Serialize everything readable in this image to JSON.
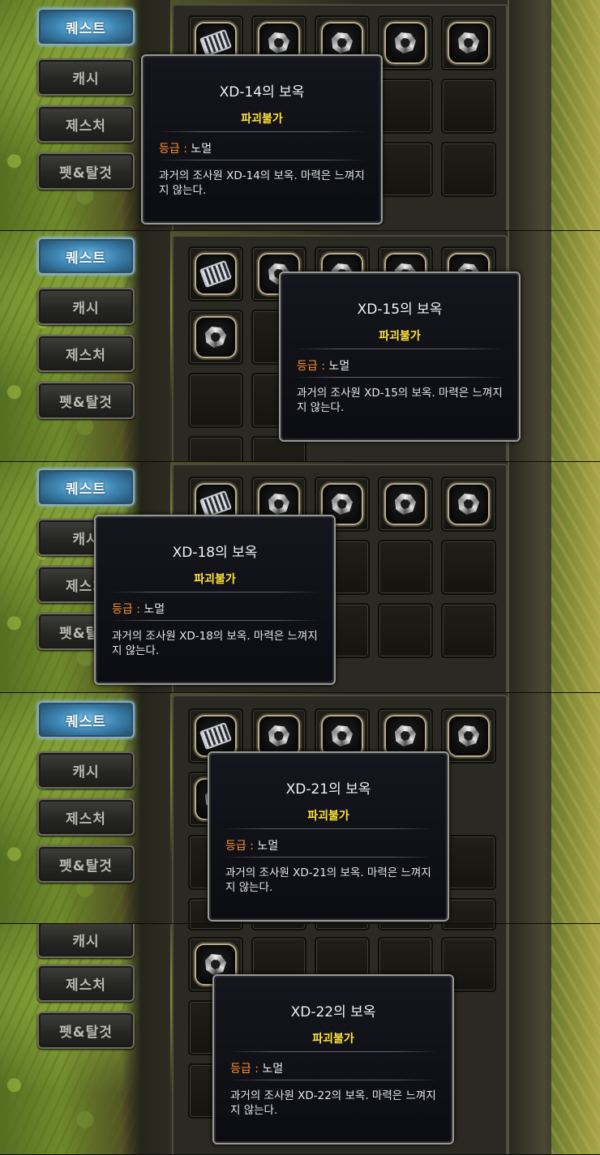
{
  "tabs": [
    "퀘스트",
    "캐시",
    "제스처",
    "펫&탈것"
  ],
  "common": {
    "destroy_flag": "파괴불가",
    "grade_label": "등급 :",
    "grade_value": "노멀"
  },
  "panels": [
    {
      "item_name": "XD-14의 보옥",
      "description": "과거의 조사원 XD-14의 보옥. 마력은 느껴지지 않는다."
    },
    {
      "item_name": "XD-15의 보옥",
      "description": "과거의 조사원 XD-15의 보옥. 마력은 느껴지지 않는다."
    },
    {
      "item_name": "XD-18의 보옥",
      "description": "과거의 조사원 XD-18의 보옥. 마력은 느껴지지 않는다."
    },
    {
      "item_name": "XD-21의 보옥",
      "description": "과거의 조사원 XD-21의 보옥. 마력은 느껴지지 않는다."
    },
    {
      "item_name": "XD-22의 보옥",
      "description": "과거의 조사원 XD-22의 보옥. 마력은 느껴지지 않는다."
    }
  ],
  "icons": {
    "cart_item": "cart-icon",
    "gem_item": "gem-icon"
  }
}
